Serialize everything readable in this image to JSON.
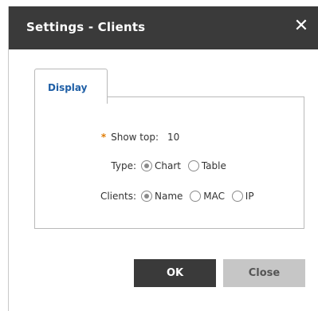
{
  "dialog": {
    "title": "Settings - Clients",
    "close_symbol": "✕"
  },
  "tabs": [
    {
      "label": "Display",
      "active": true
    }
  ],
  "form": {
    "show_top": {
      "label": "Show top:",
      "required_mark": "*",
      "value": "10"
    },
    "type": {
      "label": "Type:",
      "options": [
        {
          "label": "Chart",
          "checked": true
        },
        {
          "label": "Table",
          "checked": false
        }
      ]
    },
    "clients": {
      "label": "Clients:",
      "options": [
        {
          "label": "Name",
          "checked": true
        },
        {
          "label": "MAC",
          "checked": false
        },
        {
          "label": "IP",
          "checked": false
        }
      ]
    }
  },
  "buttons": {
    "ok_label": "OK",
    "close_label": "Close"
  },
  "colors": {
    "titlebar": "#3a3a3a",
    "tab_text": "#1f5fa6",
    "required": "#e07b00",
    "ok_bg": "#3a3a3a",
    "close_bg": "#c6c6c6"
  },
  "icons": {
    "close": "close-icon"
  }
}
